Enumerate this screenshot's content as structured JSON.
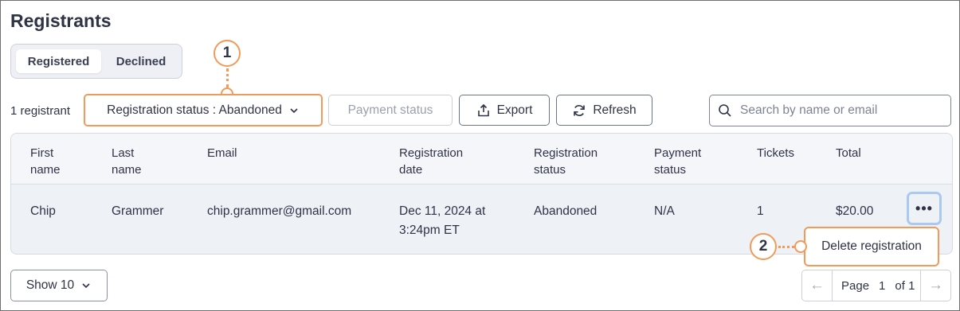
{
  "page": {
    "title": "Registrants"
  },
  "tabs": [
    {
      "label": "Registered"
    },
    {
      "label": "Declined"
    }
  ],
  "toolbar": {
    "count": "1 registrant",
    "registration_status": "Registration status : Abandoned",
    "payment_status": "Payment status",
    "export": "Export",
    "refresh": "Refresh",
    "search_placeholder": "Search by name or email"
  },
  "table": {
    "headers": [
      [
        "First",
        "name"
      ],
      [
        "Last",
        "name"
      ],
      [
        "Email"
      ],
      [
        "Registration",
        "date"
      ],
      [
        "Registration",
        "status"
      ],
      [
        "Payment",
        "status"
      ],
      [
        "Tickets"
      ],
      [
        "Total"
      ]
    ],
    "rows": [
      {
        "first_name": "Chip",
        "last_name": "Grammer",
        "email": "chip.grammer@gmail.com",
        "date_line1": "Dec 11, 2024 at",
        "date_line2": "3:24pm ET",
        "registration_status": "Abandoned",
        "payment_status": "N/A",
        "tickets": "1",
        "total": "$20.00"
      }
    ]
  },
  "row_menu": {
    "kebab": "•••",
    "delete": "Delete registration"
  },
  "callouts": {
    "one": "1",
    "two": "2"
  },
  "footer": {
    "show": "Show 10",
    "page_label": "Page",
    "page_current": "1",
    "page_total": "of 1",
    "prev_arrow": "←",
    "next_arrow": "→"
  },
  "colors": {
    "accent_orange": "#f19a5a",
    "focus_blue": "#a9c9f0",
    "text": "#2e3346"
  }
}
